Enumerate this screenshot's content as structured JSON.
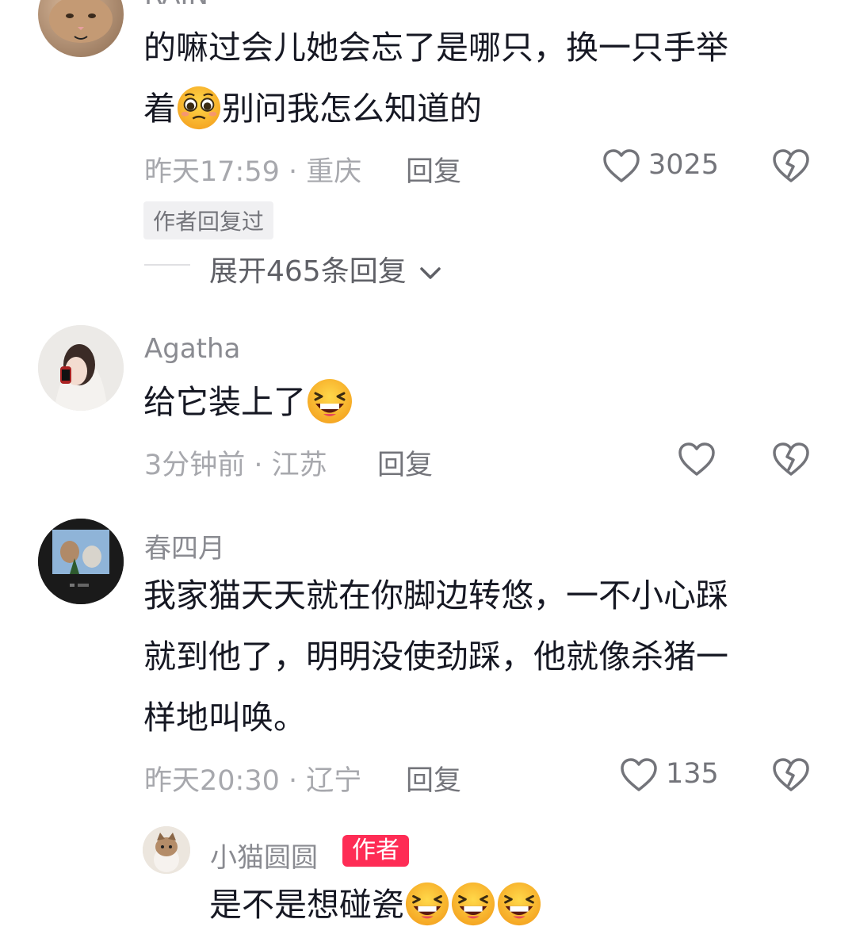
{
  "comments": [
    {
      "username": "RAIN",
      "line1": "的嘛过会儿她会忘了是哪只，换一只手举",
      "line2_pre": "着",
      "line2_post": "别问我怎么知道的",
      "meta": "昨天17:59 · 重庆",
      "reply_label": "回复",
      "like_count": "3025",
      "author_replied_tag": "作者回复过",
      "expand_label": "展开465条回复"
    },
    {
      "username": "Agatha",
      "line1": "给它装上了",
      "meta": "3分钟前 · 江苏",
      "reply_label": "回复",
      "like_count": ""
    },
    {
      "username": "春四月",
      "line1": "我家猫天天就在你脚边转悠，一不小心踩",
      "line2": "就到他了，明明没使劲踩，他就像杀猪一",
      "line3": "样地叫唤。",
      "meta": "昨天20:30 · 辽宁",
      "reply_label": "回复",
      "like_count": "135"
    }
  ],
  "reply": {
    "username": "小猫圆圆",
    "badge": "作者",
    "text": "是不是想碰瓷"
  },
  "colors": {
    "accent": "#fe2c55",
    "text": "#161823",
    "secondary": "#a7a8ad"
  },
  "icons": [
    "heart-outline-icon",
    "broken-heart-icon",
    "chevron-down-icon",
    "grin-squint-emoji",
    "pleading-emoji"
  ]
}
